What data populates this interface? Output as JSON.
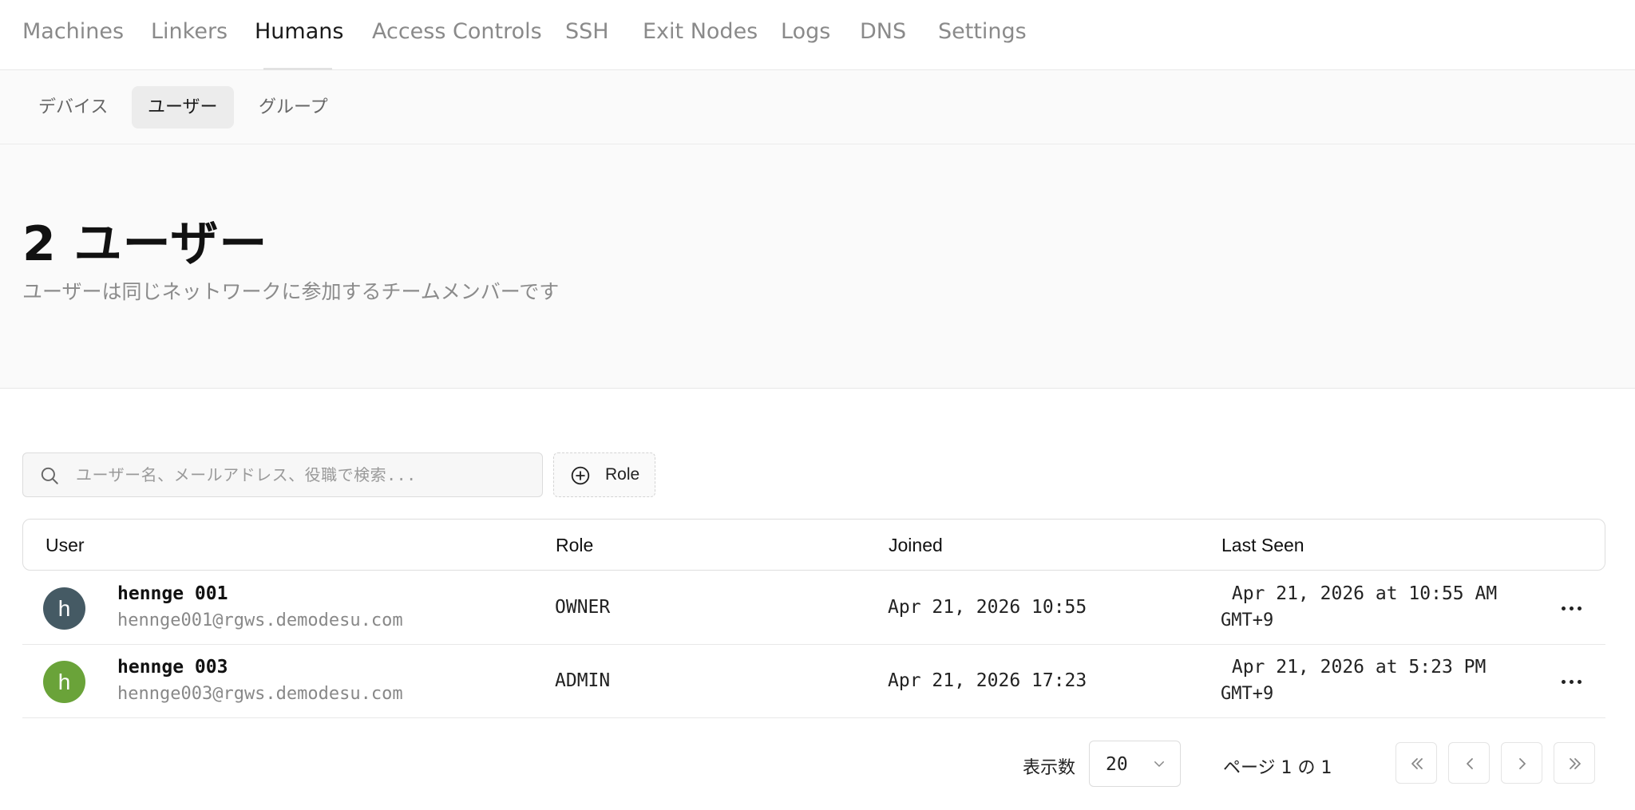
{
  "nav": {
    "tabs": [
      "Machines",
      "Linkers",
      "Humans",
      "Access Controls",
      "SSH",
      "Exit Nodes",
      "Logs",
      "DNS",
      "Settings"
    ],
    "active": "Humans"
  },
  "subnav": {
    "tabs": [
      "デバイス",
      "ユーザー",
      "グループ"
    ],
    "active": "ユーザー"
  },
  "header": {
    "title": "2 ユーザー",
    "subtitle": "ユーザーは同じネットワークに参加するチームメンバーです"
  },
  "filters": {
    "search_placeholder": "ユーザー名、メールアドレス、役職で検索...",
    "role_button": "Role",
    "search_icon": "search-icon",
    "role_icon": "plus-circle-icon"
  },
  "table": {
    "columns": [
      "User",
      "Role",
      "Joined",
      "Last Seen"
    ],
    "rows": [
      {
        "avatar_letter": "h",
        "avatar_color": "#455a64",
        "name": "hennge 001",
        "email": "hennge001@rgws.demodesu.com",
        "role": "OWNER",
        "joined": "Apr 21, 2026 10:55",
        "last_seen_line1": " Apr 21, 2026 at 10:55 AM",
        "last_seen_line2": "GMT+9"
      },
      {
        "avatar_letter": "h",
        "avatar_color": "#6aa339",
        "name": "hennge 003",
        "email": "hennge003@rgws.demodesu.com",
        "role": "ADMIN",
        "joined": "Apr 21, 2026 17:23",
        "last_seen_line1": " Apr 21, 2026 at 5:23 PM",
        "last_seen_line2": "GMT+9"
      }
    ]
  },
  "pagination": {
    "rows_label": "表示数",
    "rows_value": "20",
    "page_info": "ページ 1 の 1",
    "buttons": [
      "first-page-icon",
      "previous-page-icon",
      "next-page-icon",
      "last-page-icon"
    ]
  }
}
